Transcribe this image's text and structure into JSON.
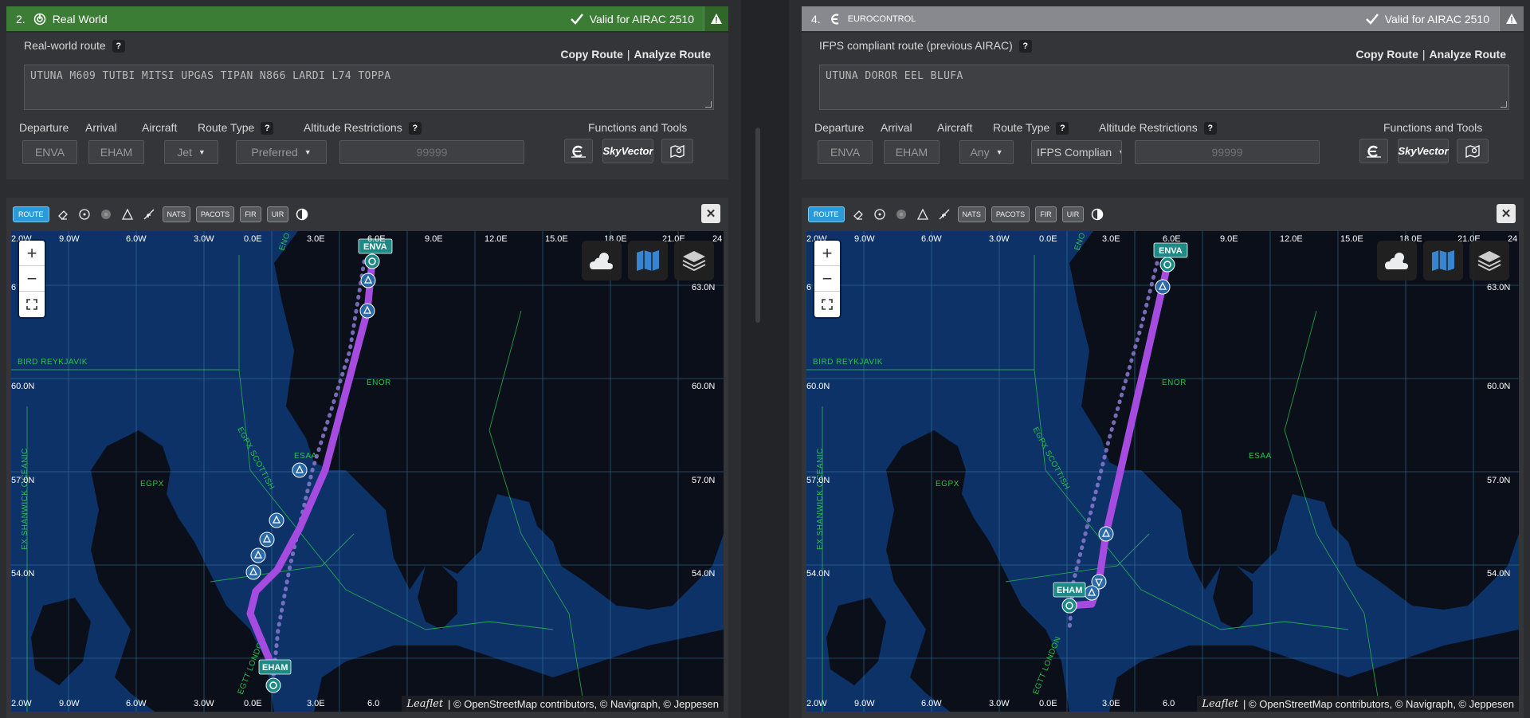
{
  "left": {
    "header": {
      "number": "2.",
      "title": "Real World",
      "valid_text": "Valid for AIRAC 2510"
    },
    "route_label": "Real-world route",
    "help": "?",
    "copy_route": "Copy Route",
    "separator": "|",
    "analyze_route": "Analyze Route",
    "route_text": "UTUNA M609 TUTBI MITSI UPGAS TIPAN N866 LARDI L74 TOPPA",
    "labels": {
      "departure": "Departure",
      "arrival": "Arrival",
      "aircraft": "Aircraft",
      "route_type": "Route Type",
      "altitude": "Altitude Restrictions",
      "tools": "Functions and Tools"
    },
    "values": {
      "departure": "ENVA",
      "arrival": "EHAM",
      "aircraft": "Jet",
      "route_type": "Preferred",
      "altitude_placeholder": "99999"
    },
    "map": {
      "toolbar": {
        "route": "ROUTE",
        "nats": "NATS",
        "pacots": "PACOTS",
        "fir": "FIR",
        "uir": "UIR"
      },
      "ticks_top": [
        "2.0W",
        "9.0W",
        "6.0W",
        "3.0W",
        "0.0E",
        "3.0E",
        "6.0E",
        "9.0E",
        "12.0E",
        "15.0E",
        "18.0E",
        "21.0E",
        "24"
      ],
      "ticks_bottom": [
        "2.0W",
        "9.0W",
        "6.0W",
        "3.0W",
        "0.0E",
        "3.0E"
      ],
      "lat_right": [
        "63.0N",
        "60.0N",
        "57.0N",
        "54.0N"
      ],
      "lat_left": [
        "6",
        "60.0N",
        "57.0N",
        "54.0N"
      ],
      "fir": [
        "BIRD REYKJAVIK",
        "ENOR",
        "EGPX",
        "EGPX SCOTTISH",
        "ESAA",
        "EGTT LONDON",
        "EX SHANWICK OCEANIC",
        "ENO"
      ],
      "airports": {
        "dep": "ENVA",
        "arr": "EHAM"
      },
      "attribution": "| © OpenStreetMap contributors, © Navigraph, © Jeppesen",
      "leaflet": "Leaflet",
      "skyvector": "SkyVector",
      "corner_tick": "6.0"
    }
  },
  "right": {
    "header": {
      "number": "4.",
      "title": "EUROCONTROL",
      "valid_text": "Valid for AIRAC 2510"
    },
    "route_label": "IFPS compliant route (previous AIRAC)",
    "help": "?",
    "copy_route": "Copy Route",
    "separator": "|",
    "analyze_route": "Analyze Route",
    "route_text": "UTUNA DOROR EEL BLUFA",
    "labels": {
      "departure": "Departure",
      "arrival": "Arrival",
      "aircraft": "Aircraft",
      "route_type": "Route Type",
      "altitude": "Altitude Restrictions",
      "tools": "Functions and Tools"
    },
    "values": {
      "departure": "ENVA",
      "arrival": "EHAM",
      "aircraft": "Any",
      "route_type": "IFPS Complian",
      "altitude_placeholder": "99999"
    },
    "map": {
      "toolbar": {
        "route": "ROUTE",
        "nats": "NATS",
        "pacots": "PACOTS",
        "fir": "FIR",
        "uir": "UIR"
      },
      "ticks_top": [
        "2.0W",
        "9.0W",
        "6.0W",
        "3.0W",
        "0.0E",
        "3.0E",
        "6.0E",
        "9.0E",
        "12.0E",
        "15.0E",
        "18.0E",
        "21.0E",
        "24"
      ],
      "ticks_bottom": [
        "2.0W",
        "9.0W",
        "6.0W",
        "3.0W",
        "0.0E",
        "3.0E",
        "6.0"
      ],
      "lat_right": [
        "63.0N",
        "60.0N",
        "57.0N",
        "54.0N"
      ],
      "lat_left": [
        "6",
        "60.0N",
        "57.0N",
        "54.0N"
      ],
      "fir": [
        "BIRD REYKJAVIK",
        "ENOR",
        "EGPX",
        "EGPX SCOTTISH",
        "ESAA",
        "EGTT LONDON",
        "EX SHANWICK OCEANIC",
        "ENO"
      ],
      "airports": {
        "dep": "ENVA",
        "arr": "EHAM"
      },
      "attribution": "| © OpenStreetMap contributors, © Navigraph, © Jeppesen",
      "leaflet": "Leaflet",
      "skyvector": "SkyVector"
    }
  },
  "colors": {
    "route": "#a64be0",
    "header_green": "#3b7d34",
    "header_gray": "#87898e",
    "sea": "#0c3268",
    "land": "#0a0f1a",
    "fir": "#2bc24d"
  }
}
